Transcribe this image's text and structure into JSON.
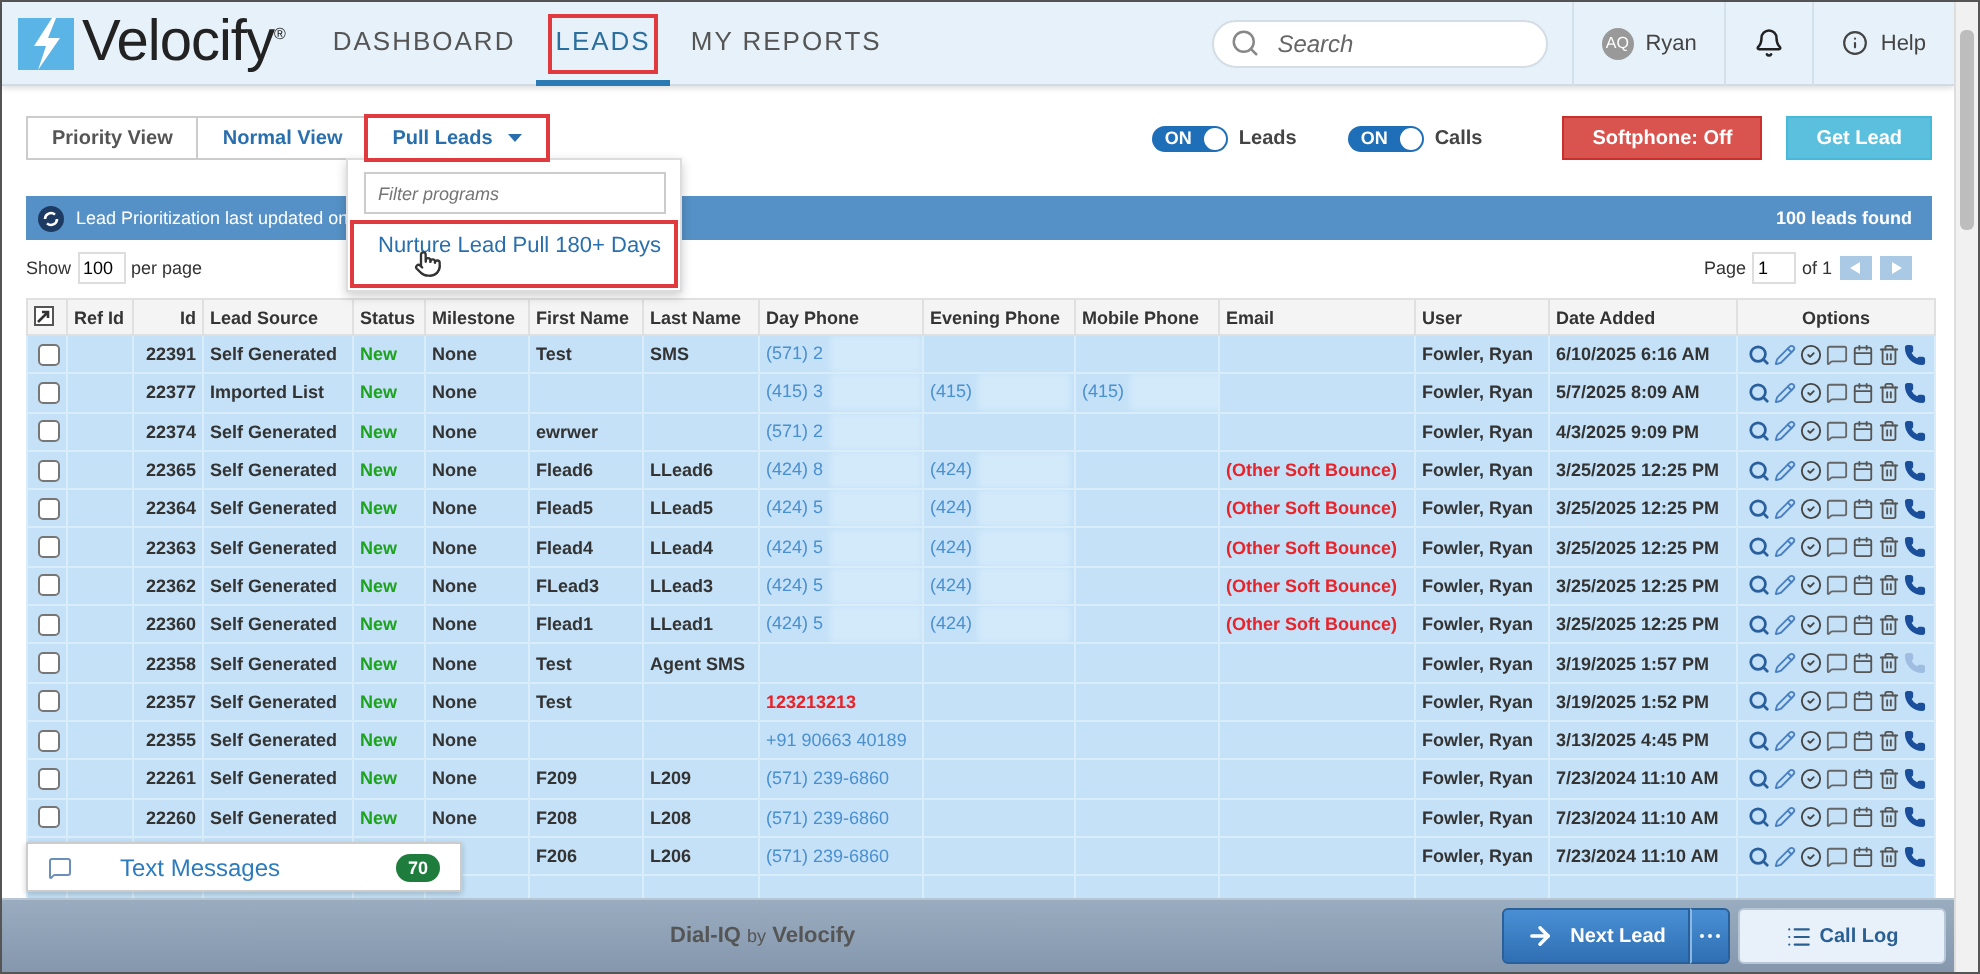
{
  "header": {
    "app_name": "Velocify$^{®}$",
    "nav": [
      {
        "label": "DASHBOARD",
        "selected": false,
        "annotated": false
      },
      {
        "label": "LEADS",
        "selected": true,
        "annotated": true
      },
      {
        "label": "MY REPORTS",
        "selected": false,
        "annotated": false
      }
    ],
    "search": {
      "placeholder": "Search"
    },
    "user": {
      "initials": "AQ",
      "name": "Ryan"
    },
    "help": "Help"
  },
  "views": [
    {
      "label": "Priority View",
      "annotated": false,
      "dropdown": false
    },
    {
      "label": "Normal View",
      "annotated": false,
      "dropdown": false
    },
    {
      "label": "Pull Leads",
      "annotated": true,
      "dropdown": true
    }
  ],
  "toggles": [
    {
      "state_text": "ON",
      "label": "Leads",
      "on": true
    },
    {
      "state_text": "ON",
      "label": "Calls",
      "on": true
    }
  ],
  "actions": [
    {
      "label": "Softphone: Off",
      "kind": "danger"
    },
    {
      "label": "Get Lead",
      "kind": "info"
    }
  ],
  "pull_menu": {
    "placeholder": "Filter programs",
    "items": [
      {
        "label": "Nurture Lead Pull 180+ Days",
        "annotated": true
      }
    ]
  },
  "banner": {
    "text": "Lead Prioritization last updated on",
    "count": "100 leads found"
  },
  "paging": {
    "show": "Show",
    "per_page_value": "100",
    "per_page": "per page",
    "page": "Page",
    "page_value": "1",
    "of": "of 1"
  },
  "table": {
    "columns": [
      "Ref Id",
      "Id",
      "Lead Source",
      "Status",
      "Milestone",
      "First Name",
      "Last Name",
      "Day Phone",
      "Evening Phone",
      "Mobile Phone",
      "Email",
      "User",
      "Date Added",
      "Options"
    ],
    "rows": [
      {
        "checked": false,
        "id": "22391",
        "source": "Self Generated",
        "status": "New",
        "milestone": "None",
        "first": "Test",
        "last": "SMS",
        "day": {
          "text": "(571) 2",
          "blurred": true,
          "invalid": false
        },
        "evening": null,
        "mobile": null,
        "email": "",
        "user": "Fowler, Ryan",
        "date": "6/10/2025 6:16 AM",
        "call_enabled": true
      },
      {
        "checked": false,
        "id": "22377",
        "source": "Imported List",
        "status": "New",
        "milestone": "None",
        "first": "",
        "last": "",
        "day": {
          "text": "(415) 3",
          "blurred": true,
          "invalid": false
        },
        "evening": {
          "text": "(415)",
          "blurred": true,
          "invalid": false
        },
        "mobile": {
          "text": "(415)",
          "blurred": true,
          "invalid": false
        },
        "email": "",
        "user": "Fowler, Ryan",
        "date": "5/7/2025 8:09 AM",
        "call_enabled": true
      },
      {
        "checked": false,
        "id": "22374",
        "source": "Self Generated",
        "status": "New",
        "milestone": "None",
        "first": "ewrwer",
        "last": "",
        "day": {
          "text": "(571) 2",
          "blurred": true,
          "invalid": false
        },
        "evening": null,
        "mobile": null,
        "email": "",
        "user": "Fowler, Ryan",
        "date": "4/3/2025 9:09 PM",
        "call_enabled": true
      },
      {
        "checked": false,
        "id": "22365",
        "source": "Self Generated",
        "status": "New",
        "milestone": "None",
        "first": "Flead6",
        "last": "LLead6",
        "day": {
          "text": "(424) 8",
          "blurred": true,
          "invalid": false
        },
        "evening": {
          "text": "(424)",
          "blurred": true,
          "invalid": false
        },
        "mobile": null,
        "email": "(Other Soft Bounce)",
        "user": "Fowler, Ryan",
        "date": "3/25/2025 12:25 PM",
        "call_enabled": true
      },
      {
        "checked": false,
        "id": "22364",
        "source": "Self Generated",
        "status": "New",
        "milestone": "None",
        "first": "Flead5",
        "last": "LLead5",
        "day": {
          "text": "(424) 5",
          "blurred": true,
          "invalid": false
        },
        "evening": {
          "text": "(424)",
          "blurred": true,
          "invalid": false
        },
        "mobile": null,
        "email": "(Other Soft Bounce)",
        "user": "Fowler, Ryan",
        "date": "3/25/2025 12:25 PM",
        "call_enabled": true
      },
      {
        "checked": false,
        "id": "22363",
        "source": "Self Generated",
        "status": "New",
        "milestone": "None",
        "first": "Flead4",
        "last": "LLead4",
        "day": {
          "text": "(424) 5",
          "blurred": true,
          "invalid": false
        },
        "evening": {
          "text": "(424)",
          "blurred": true,
          "invalid": false
        },
        "mobile": null,
        "email": "(Other Soft Bounce)",
        "user": "Fowler, Ryan",
        "date": "3/25/2025 12:25 PM",
        "call_enabled": true
      },
      {
        "checked": false,
        "id": "22362",
        "source": "Self Generated",
        "status": "New",
        "milestone": "None",
        "first": "FLead3",
        "last": "LLead3",
        "day": {
          "text": "(424) 5",
          "blurred": true,
          "invalid": false
        },
        "evening": {
          "text": "(424)",
          "blurred": true,
          "invalid": false
        },
        "mobile": null,
        "email": "(Other Soft Bounce)",
        "user": "Fowler, Ryan",
        "date": "3/25/2025 12:25 PM",
        "call_enabled": true
      },
      {
        "checked": false,
        "id": "22360",
        "source": "Self Generated",
        "status": "New",
        "milestone": "None",
        "first": "Flead1",
        "last": "LLead1",
        "day": {
          "text": "(424) 5",
          "blurred": true,
          "invalid": false
        },
        "evening": {
          "text": "(424)",
          "blurred": true,
          "invalid": false
        },
        "mobile": null,
        "email": "(Other Soft Bounce)",
        "user": "Fowler, Ryan",
        "date": "3/25/2025 12:25 PM",
        "call_enabled": true
      },
      {
        "checked": false,
        "id": "22358",
        "source": "Self Generated",
        "status": "New",
        "milestone": "None",
        "first": "Test",
        "last": "Agent SMS",
        "day": null,
        "evening": null,
        "mobile": null,
        "email": "",
        "user": "Fowler, Ryan",
        "date": "3/19/2025 1:57 PM",
        "call_enabled": false
      },
      {
        "checked": false,
        "id": "22357",
        "source": "Self Generated",
        "status": "New",
        "milestone": "None",
        "first": "Test",
        "last": "",
        "day": {
          "text": "123213213",
          "invalid": true
        },
        "evening": null,
        "mobile": null,
        "email": "",
        "user": "Fowler, Ryan",
        "date": "3/19/2025 1:52 PM",
        "call_enabled": true
      },
      {
        "checked": false,
        "id": "22355",
        "source": "Self Generated",
        "status": "New",
        "milestone": "None",
        "first": "",
        "last": "",
        "day": {
          "text": "+91 90663 40189",
          "invalid": false
        },
        "evening": null,
        "mobile": null,
        "email": "",
        "user": "Fowler, Ryan",
        "date": "3/13/2025 4:45 PM",
        "call_enabled": true
      },
      {
        "checked": false,
        "id": "22261",
        "source": "Self Generated",
        "status": "New",
        "milestone": "None",
        "first": "F209",
        "last": "L209",
        "day": {
          "text": "(571) 239-6860",
          "invalid": false
        },
        "evening": null,
        "mobile": null,
        "email": "",
        "user": "Fowler, Ryan",
        "date": "7/23/2024 11:10 AM",
        "call_enabled": true
      },
      {
        "checked": false,
        "id": "22260",
        "source": "Self Generated",
        "status": "New",
        "milestone": "None",
        "first": "F208",
        "last": "L208",
        "day": {
          "text": "(571) 239-6860",
          "invalid": false
        },
        "evening": null,
        "mobile": null,
        "email": "",
        "user": "Fowler, Ryan",
        "date": "7/23/2024 11:10 AM",
        "call_enabled": true
      },
      {
        "first": "F206",
        "last": "L206",
        "day": {
          "text": "(571) 239-6860",
          "invalid": false
        },
        "evening": null,
        "mobile": null,
        "email": "",
        "user": "Fowler, Ryan",
        "date": "7/23/2024 11:10 AM",
        "call_enabled": true
      }
    ]
  },
  "text_messages": {
    "label": "Text Messages",
    "count": "70"
  },
  "footer": {
    "brand": "Dial-IQ",
    "by": "by",
    "brand_owner": "Velocify",
    "next": "Next Lead",
    "call_log": "Call Log"
  }
}
